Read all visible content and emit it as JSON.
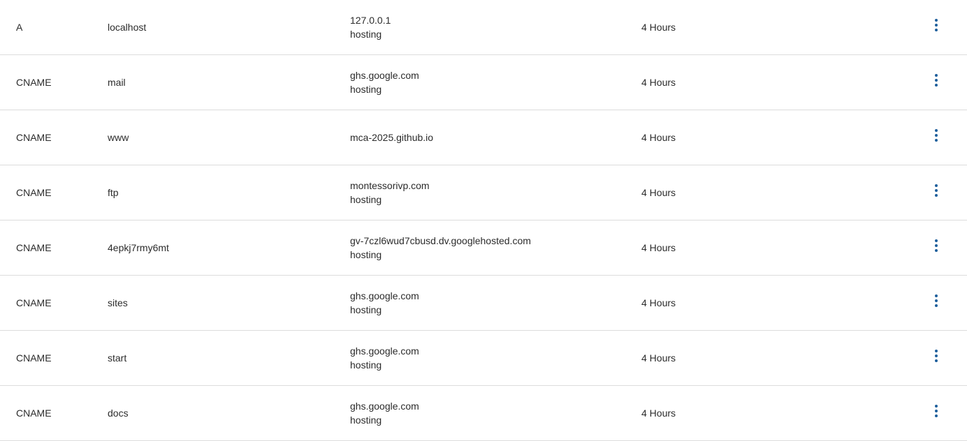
{
  "records": [
    {
      "type": "A",
      "name": "localhost",
      "data": [
        "127.0.0.1",
        "hosting"
      ],
      "ttl": "4 Hours"
    },
    {
      "type": "CNAME",
      "name": "mail",
      "data": [
        "ghs.google.com",
        "hosting"
      ],
      "ttl": "4 Hours"
    },
    {
      "type": "CNAME",
      "name": "www",
      "data": [
        "mca-2025.github.io"
      ],
      "ttl": "4 Hours"
    },
    {
      "type": "CNAME",
      "name": "ftp",
      "data": [
        "montessorivp.com",
        "hosting"
      ],
      "ttl": "4 Hours"
    },
    {
      "type": "CNAME",
      "name": "4epkj7rmy6mt",
      "data": [
        "gv-7czl6wud7cbusd.dv.googlehosted.com",
        "hosting"
      ],
      "ttl": "4 Hours"
    },
    {
      "type": "CNAME",
      "name": "sites",
      "data": [
        "ghs.google.com",
        "hosting"
      ],
      "ttl": "4 Hours"
    },
    {
      "type": "CNAME",
      "name": "start",
      "data": [
        "ghs.google.com",
        "hosting"
      ],
      "ttl": "4 Hours"
    },
    {
      "type": "CNAME",
      "name": "docs",
      "data": [
        "ghs.google.com",
        "hosting"
      ],
      "ttl": "4 Hours"
    }
  ],
  "icons": {
    "row_actions": "more-vertical-icon",
    "accent_color": "#1f5f9c"
  }
}
